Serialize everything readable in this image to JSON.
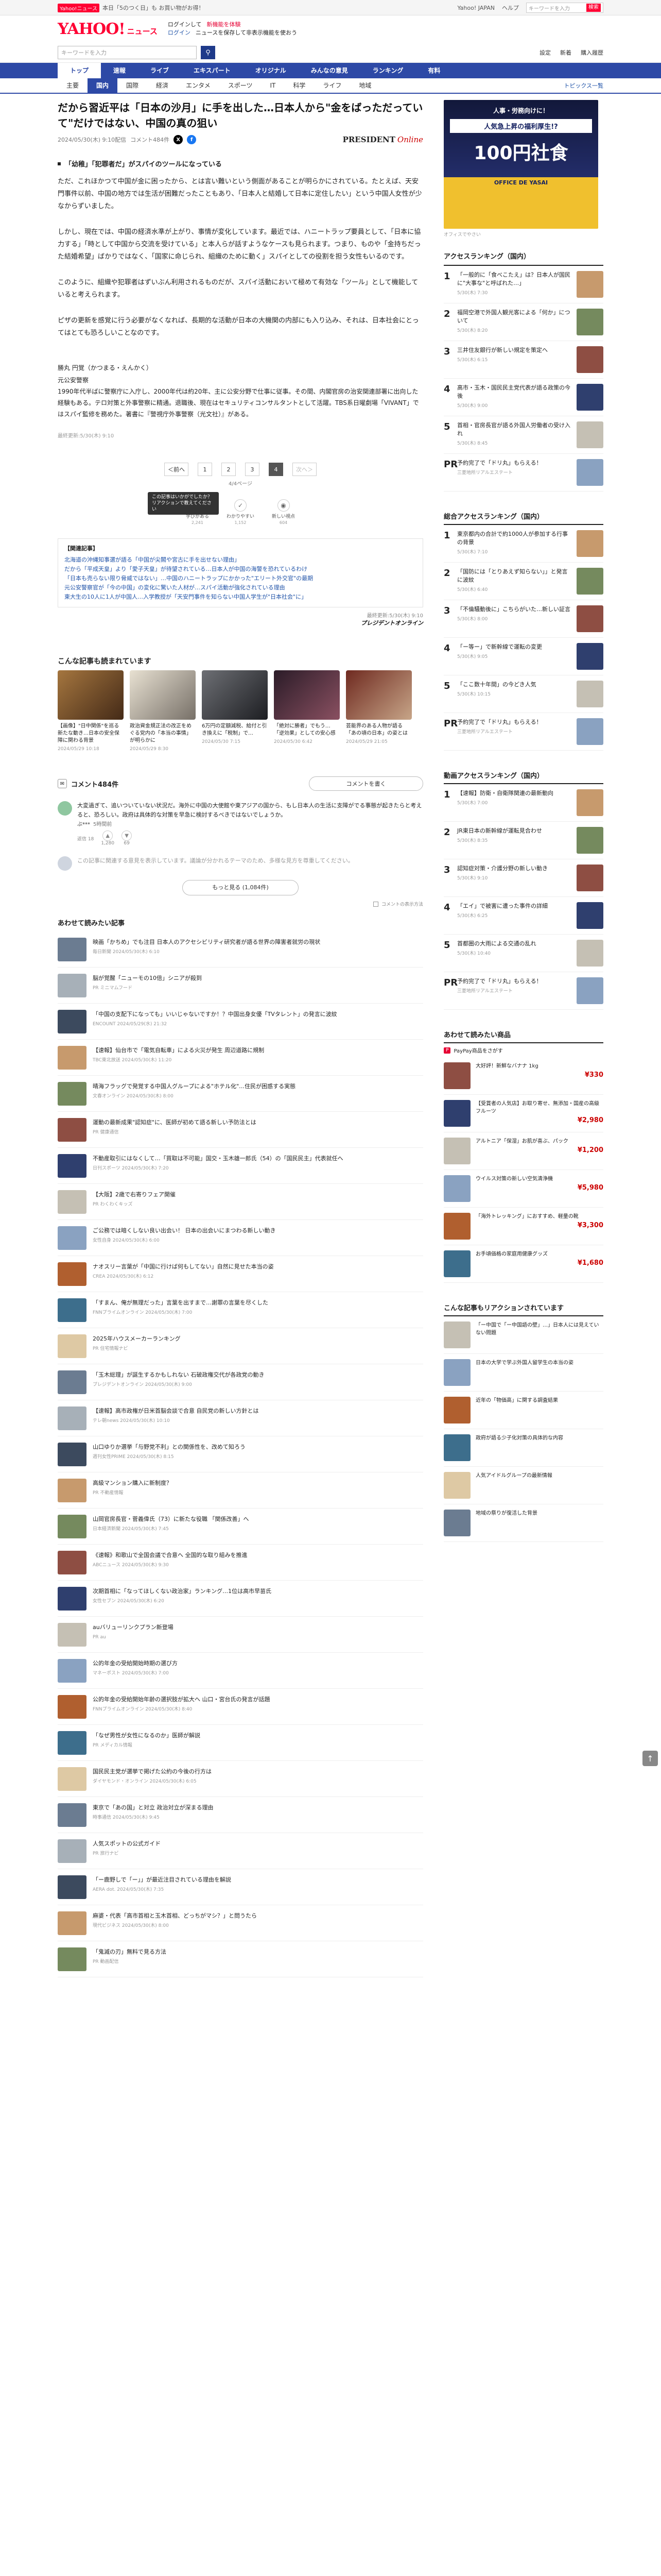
{
  "topbar": {
    "promo_badge": "Yahoo!ニュース",
    "promo_text": "本日「5のつく日」も お買い物がお得！",
    "links": [
      "Yahoo! JAPAN",
      "ヘルプ"
    ],
    "search_placeholder": "キーワードを入力",
    "search_button": "検索"
  },
  "header": {
    "logo_main": "YAHOO!",
    "logo_sub": "ニュース",
    "line1_prefix": "ログインして",
    "line1_red": "新機能を体験",
    "line1_suffix": "",
    "line2_prefix": "ログイン",
    "line2_blue": "ニュースを保存して非表示機能を使おう",
    "search_placeholder": "キーワードを入力",
    "right_links": [
      "設定",
      "新着",
      "購入履歴"
    ]
  },
  "nav_primary": [
    "トップ",
    "速報",
    "ライブ",
    "エキスパート",
    "オリジナル",
    "みんなの意見",
    "ランキング",
    "有料"
  ],
  "nav_secondary": [
    "主要",
    "国内",
    "国際",
    "経済",
    "エンタメ",
    "スポーツ",
    "IT",
    "科学",
    "ライフ",
    "地域"
  ],
  "nav_more": "トピックス一覧",
  "article": {
    "title": "だから習近平は「日本の沙月」に手を出した…日本人から\"金をばっただっていて\"だけではない、中国の真の狙い",
    "date": "2024/05/30(木) 9:10配信",
    "comment_count": "コメント484件",
    "publisher": "PRESIDENT",
    "publisher_sub": "Online",
    "section_heading": "「幼稚」「犯罪者だ」がスパイのツールになっている",
    "paragraphs": [
      "ただ、これほかつて中国が金に困ったから、とは言い難いという側面があることが明らかにされている。たとえば、天安門事件以前、中国の地方では生活が困難だったこともあり、「日本人と結婚して日本に定住したい」という中国人女性が少なからずいました。",
      "しかし、現在では、中国の経済水準が上がり、事情が変化しています。最近では、ハニートラップ要員として、「日本に協力する」「時として中国から交流を受けている」と本人らが話すようなケースも見られます。つまり、ものや「金持ちだった結婚希望」ばかりではなく、「国家に命じられ、組織のために動く」スパイとしての役割を担う女性もいるのです。",
      "このように、組織や犯罪者はずいぶん利用されるものだが、スパイ活動において極めて有効な「ツール」として機能していると考えられます。",
      "ピザの更新を感覚に行う必要がなくなれば、長期的な活動が日本の大機関の内部にも入り込み、それは、日本社会にとってはとても恐ろしいことなのです。"
    ],
    "author_name": "勝丸 円覚（かつまる・えんかく）",
    "author_role": "元公安警察",
    "author_bio": "1990年代半ばに警察庁に入庁し、2000年代は約20年、主に公安分野で仕事に従事。その間、内閣官房の治安関連部署に出向した経験もある。テロ対策と外事警察に精通。退職後、現在はセキュリティコンサルタントとして活躍。TBS系日曜劇場「VIVANT」ではスパイ監修を務めた。著書に『警視庁外事警察（光文社）』がある。",
    "copyright": "最終更新:5/30(木) 9:10",
    "pager": [
      "＜前へ",
      "1",
      "2",
      "3",
      "4",
      "次へ＞"
    ],
    "pager_current": "4",
    "pager_sub": "4/4ページ",
    "tooltip": "この記事はいかがでしたか？リアクションで教えてください",
    "reactions": [
      {
        "label": "学びがある",
        "count": "2,241"
      },
      {
        "label": "わかりやすい",
        "count": "1,152"
      },
      {
        "label": "新しい視点",
        "count": "604"
      }
    ],
    "related_label": "【関連記事】",
    "related_links": [
      "北海道の沖縄知事選が語る「中国が尖閣や宮古に手を出せない理由」",
      "だから「平成天皇」より「愛子天皇」が待望されている…日本人が中国の海警を恐れているわけ",
      "「日本も売らない限り脅威ではない」…中国のハニートラップにかかった\"エリート外交官\"の最期",
      "元公安警察官が「今の中国」の変化に驚いた人材が…スパイ活動が強化されている理由",
      "東大生の10人に1人が中国人…入学教授が「天安門事件を知らない中国人学生が\"日本社会\"に」"
    ],
    "source": "最終更新:5/30(木) 9:10",
    "source_brand": "プレジデントオンライン"
  },
  "recommended": {
    "heading": "こんな記事も読まれています",
    "cards": [
      {
        "text": "【画像】\"日中関係\"を巡る新たな動き…日本の安全保障に関わる背景",
        "date": "2024/05/29 10:18"
      },
      {
        "text": "政治資金規正法の改正をめぐる党内の「本当の事情」が明らかに",
        "date": "2024/05/29 8:30"
      },
      {
        "text": "6万円の定額減税、給付と引き換えに「税制」で…",
        "date": "2024/05/30 7:15"
      },
      {
        "text": "「絶対に勝者」でもう…「逆効果」としての安心感",
        "date": "2024/05/30 6:42"
      },
      {
        "text": "芸能界のある人物が語る「あの頃の日本」の姿とは",
        "date": "2024/05/29 21:05"
      }
    ]
  },
  "comments": {
    "heading": "コメント484件",
    "write_button": "コメントを書く",
    "items": [
      {
        "text": "大変過ぎて、追いついていない状況だ。海外に中国の大使館や東アジアの国から、もし日本人の生活に支障がでる事態が起きたらと考えると、恐ろしい。政府は具体的な対策を早急に検討するべきではないでしょうか。",
        "user": "ぶ***",
        "time": "5時間前",
        "likes": "1,280",
        "dislikes": "69",
        "replies": "返信 18"
      },
      {
        "text": "この記事に関連する意見を表示しています。議論が分かれるテーマのため、多様な見方を尊重してください。",
        "user": "",
        "time": "",
        "likes": "",
        "dislikes": "",
        "replies": ""
      }
    ],
    "more_button": "もっと見る (1,084件)",
    "note": "コメントの表示方法"
  },
  "feed": {
    "heading": "あわせて読みたい記事",
    "items": [
      {
        "text": "映画「かちめ」でも注目 日本人のアクセシビリティ研究者が語る世界の障害者就労の現状",
        "meta": "毎日新聞 2024/05/30(木) 6:10"
      },
      {
        "text": "脳が覚醒「ニューモの10倍」シニアが殺到",
        "meta": "PR ミニマムフード"
      },
      {
        "text": "「中国の支配下になっても」いいじゃないですか！？中国出身女優「TVタレント」の発言に波紋",
        "meta": "ENCOUNT 2024/05/29(水) 21:32"
      },
      {
        "text": "【速報】仙台市で「電気自転車」による火災が発生 周辺道路に規制",
        "meta": "TBC東北放送 2024/05/30(木) 11:20"
      },
      {
        "text": "晴海フラッグで発覚する中国人グループによる\"ホテル化\"…住民が困惑する実態",
        "meta": "文春オンライン 2024/05/30(木) 8:00"
      },
      {
        "text": "運動の最新成果\"認知症\"に、医師が初めて語る新しい予防法とは",
        "meta": "PR 健康通信"
      },
      {
        "text": "不動産取引にはなくして…「買取は不可能」国交・玉木雄一郎氏（54）の「国民民主」代表就任へ",
        "meta": "日刊スポーツ 2024/05/30(木) 7:20"
      },
      {
        "text": "【大阪】2歳で右寄りフェア開催",
        "meta": "PR わくわくキッズ"
      },
      {
        "text": "ご公務では暗くしない良い出会い！ 日本の出会いにまつわる新しい動き",
        "meta": "女性自身 2024/05/30(木) 6:00"
      },
      {
        "text": "ナオスリー言葉が「中国に行けば何もしてない」自然に見せた本当の姿",
        "meta": "CREA 2024/05/30(木) 6:12"
      },
      {
        "text": "「すまん、俺が無理だった」言葉を出すまで…謝罪の言葉を尽くした",
        "meta": "FNNプライムオンライン 2024/05/30(木) 7:00"
      },
      {
        "text": "2025年ハウスメーカーランキング",
        "meta": "PR 住宅情報ナビ"
      },
      {
        "text": "「玉木総理」が誕生するかもしれない 石破政権交代が各政党の動き",
        "meta": "プレジデントオンライン 2024/05/30(木) 9:00"
      },
      {
        "text": "【速報】高市政権が日米首脳会談で合意 自民党の新しい方針とは",
        "meta": "テレ朝news 2024/05/30(木) 10:10"
      },
      {
        "text": "山口ゆりか選挙「与野党不利」との関係性を、改めて知ろう",
        "meta": "週刊女性PRIME 2024/05/30(木) 8:15"
      },
      {
        "text": "高級マンション購入に新制度？",
        "meta": "PR 不動産情報"
      },
      {
        "text": "山岡官房長官・菅義偉氏（73）に新たな役職 「関係改善」へ",
        "meta": "日本経済新聞 2024/05/30(木) 7:45"
      },
      {
        "text": "《速報》和歌山で全国会議で合意へ 全国的な取り組みを推進",
        "meta": "ABCニュース 2024/05/30(木) 9:30"
      },
      {
        "text": "次期首相に「なってほしくない政治家」ランキング…1位は高市早苗氏",
        "meta": "女性セブン 2024/05/30(木) 6:20"
      },
      {
        "text": "auバリューリンクプラン新登場",
        "meta": "PR au"
      },
      {
        "text": "公的年金の受給開始時期の選び方",
        "meta": "マネーポスト 2024/05/30(木) 7:00"
      },
      {
        "text": "公的年金の受給開始年齢の選択肢が拡大へ 山口・宮台氏の発言が話題",
        "meta": "FNNプライムオンライン 2024/05/30(木) 8:40"
      },
      {
        "text": "「なぜ男性が女性になるのか」医師が解説",
        "meta": "PR メディカル情報"
      },
      {
        "text": "国民民主党が選挙で掲げた公約の今後の行方は",
        "meta": "ダイヤモンド・オンライン 2024/05/30(木) 6:05"
      },
      {
        "text": "東京で「あの国」と対立 政治対立が深まる理由",
        "meta": "時事通信 2024/05/30(木) 9:45"
      },
      {
        "text": "人気スポットの公式ガイド",
        "meta": "PR 旅行ナビ"
      },
      {
        "text": "「ー鹿野しで「ー」」が最近注目されている理由を解説",
        "meta": "AERA dot. 2024/05/30(木) 7:35"
      },
      {
        "text": "麻婆・代表「高市首相と玉木首相、どっちがマシ？」と問うたら",
        "meta": "現代ビジネス 2024/05/30(木) 8:00"
      },
      {
        "text": "「鬼滅の刃」無料で見る方法",
        "meta": "PR 動画配信"
      }
    ]
  },
  "sidebar": {
    "ad_line1": "人事・労務向けに！",
    "ad_line2": "人気急上昇の福利厚生!?",
    "ad_line3": "100円社食",
    "ad_line4": "OFFICE DE YASAI",
    "ad_meta": "オフィスでやさい",
    "ranking_heading": "アクセスランキング（国内）",
    "ranking": [
      {
        "no": "1",
        "text": "「一般的に「食べこたえ」は？日本人が国民に\"大事な\"と呼ばれた…」",
        "date": "5/30(木) 7:30"
      },
      {
        "no": "2",
        "text": "福岡空港で外国人観光客による「何か」について",
        "date": "5/30(木) 8:20"
      },
      {
        "no": "3",
        "text": "三井住友銀行が新しい規定を策定へ",
        "date": "5/30(木) 6:15"
      },
      {
        "no": "4",
        "text": "高市・玉木・国民民主党代表が語る政策の今後",
        "date": "5/30(木) 9:00"
      },
      {
        "no": "5",
        "text": "首相・官房長官が語る外国人労働者の受け入れ",
        "date": "5/30(木) 8:45"
      },
      {
        "no": "PR",
        "text": "予約完了で「ドリ丸」もらえる！",
        "date": "三菱地所リアルエステート"
      }
    ],
    "ranking2_heading": "総合アクセスランキング（国内）",
    "ranking2": [
      {
        "no": "1",
        "text": "東京都内の合計で約1000人が参加する行事の背景",
        "date": "5/30(木) 7:10"
      },
      {
        "no": "2",
        "text": "「国防には「とりあえず知らない」」と発言に波紋",
        "date": "5/30(木) 6:40"
      },
      {
        "no": "3",
        "text": "「不倫騒動後に」こちらがいた…新しい証言",
        "date": "5/30(木) 8:00"
      },
      {
        "no": "4",
        "text": "「ー等ー」で新幹線で運転の変更",
        "date": "5/30(木) 9:05"
      },
      {
        "no": "5",
        "text": "「ここ数十年間」の今どき人気",
        "date": "5/30(木) 10:15"
      },
      {
        "no": "PR",
        "text": "予約完了で「ドリ丸」もらえる！",
        "date": "三菱地所リアルエステート"
      }
    ],
    "ranking3_heading": "動画アクセスランキング（国内）",
    "ranking3": [
      {
        "no": "1",
        "text": "【速報】防衛・自衛隊関連の最新動向",
        "date": "5/30(木) 7:00"
      },
      {
        "no": "2",
        "text": "JR東日本の新幹線が運転見合わせ",
        "date": "5/30(木) 8:35"
      },
      {
        "no": "3",
        "text": "認知症対策・介護分野の新しい動き",
        "date": "5/30(木) 9:10"
      },
      {
        "no": "4",
        "text": "「エイ」で被害に遭った事件の詳細",
        "date": "5/30(木) 6:25"
      },
      {
        "no": "5",
        "text": "首都圏の大雨による交通の乱れ",
        "date": "5/30(木) 10:40"
      },
      {
        "no": "PR",
        "text": "予約完了で「ドリ丸」もらえる！",
        "date": "三菱地所リアルエステート"
      }
    ],
    "shop_heading": "あわせて読みたい商品",
    "shop_paypay": "PayPay商品をさがす",
    "shop": [
      {
        "text": "大好評！新鮮なバナナ 1kg",
        "price": "¥330"
      },
      {
        "text": "【受賞者の人気店】お取り寄せ、無添加・国産の高級フルーツ",
        "price": "¥2,980"
      },
      {
        "text": "アルトニア「保湿」お肌が喜ぶ、パック",
        "price": "¥1,200"
      },
      {
        "text": "ウイルス対策の新しい空気清浄機",
        "price": "¥5,980"
      },
      {
        "text": "「海外トレッキング」におすすめ、軽量の靴",
        "price": "¥3,300"
      },
      {
        "text": "お手頃価格の家庭用健康グッズ",
        "price": "¥1,680"
      }
    ],
    "shop2_heading": "こんな記事もリアクションされています",
    "shop2": [
      {
        "text": "「ー中国で「ー中国語の壁」…」日本人には見えていない問題"
      },
      {
        "text": "日本の大学で学ぶ外国人留学生の本当の姿"
      },
      {
        "text": "近年の「物価高」に関する調査結果"
      },
      {
        "text": "政府が語る少子化対策の具体的な内容"
      },
      {
        "text": "人気アイドルグループの最新情報"
      },
      {
        "text": "地域の祭りが復活した背景"
      }
    ]
  }
}
